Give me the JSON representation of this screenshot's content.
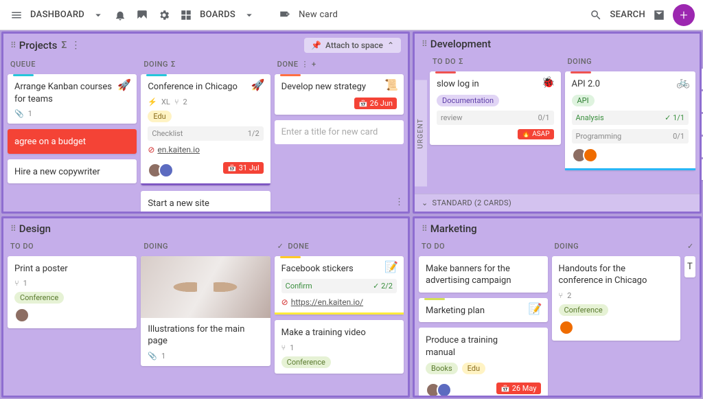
{
  "topbar": {
    "dashboard": "DASHBOARD",
    "boards": "BOARDS",
    "new_card": "New card",
    "search": "SEARCH"
  },
  "side_tools": [
    "people-icon",
    "filter-icon",
    "timer-icon",
    "history-icon",
    "copy-icon"
  ],
  "boards": {
    "projects": {
      "title": "Projects",
      "attach": "Attach to space",
      "lanes": {
        "queue": {
          "label": "QUEUE"
        },
        "doing": {
          "label": "DOING"
        },
        "done": {
          "label": "DONE"
        }
      },
      "cards": {
        "q1": {
          "title": "Arrange Kanban courses for teams",
          "attachments": "1"
        },
        "q2": {
          "title": "agree on a budget"
        },
        "q3": {
          "title": "Hire a new copywriter"
        },
        "d1": {
          "title": "Conference in Chicago",
          "size": "XL",
          "members": "2",
          "tag": "Edu",
          "checklist_label": "Checklist",
          "checklist_count": "1/2",
          "link": "en.kaiten.io",
          "due": "31 Jul"
        },
        "d2": {
          "title": "Start a new site"
        },
        "done1": {
          "title": "Develop new strategy",
          "due": "26 Jun"
        },
        "new_placeholder": "Enter a title for new card"
      }
    },
    "development": {
      "title": "Development",
      "urgent_label": "URGENT",
      "standard_label": "STANDARD (2 CARDS)",
      "lanes": {
        "todo": {
          "label": "TO DO"
        },
        "doing": {
          "label": "DOING"
        }
      },
      "cards": {
        "t1": {
          "title": "slow log in",
          "tag": "Documentation",
          "check_label": "review",
          "check_count": "0/1",
          "asap": "ASAP"
        },
        "g1": {
          "title": "API 2.0",
          "tag": "API",
          "rows": [
            {
              "label": "Analysis",
              "count": "1/1",
              "done": true
            },
            {
              "label": "Programming",
              "count": "0/1",
              "done": false
            }
          ]
        }
      }
    },
    "design": {
      "title": "Design",
      "lanes": {
        "todo": {
          "label": "TO DO"
        },
        "doing": {
          "label": "DOING"
        },
        "done": {
          "label": "DONE"
        }
      },
      "cards": {
        "t1": {
          "title": "Print a poster",
          "members": "1",
          "tag": "Conference"
        },
        "d1": {
          "title": "Illustrations for the main page",
          "attachments": "1"
        },
        "n1": {
          "title": "Facebook stickers",
          "check_label": "Confirm",
          "check_count": "2/2",
          "link": "https://en.kaiten.io/"
        },
        "n2": {
          "title": "Make a training video",
          "members": "1",
          "tag": "Conference"
        }
      }
    },
    "marketing": {
      "title": "Marketing",
      "lanes": {
        "todo": {
          "label": "TO DO"
        },
        "doing": {
          "label": "DOING"
        }
      },
      "cards": {
        "t1": {
          "title": "Make banners for the advertising campaign"
        },
        "t2": {
          "title": "Marketing plan"
        },
        "t3": {
          "title": "Produce a training manual",
          "tag1": "Books",
          "tag2": "Edu",
          "due": "26 May"
        },
        "g1": {
          "title": "Handouts for the conference in Chicago",
          "members": "2",
          "tag": "Conference"
        }
      }
    }
  }
}
